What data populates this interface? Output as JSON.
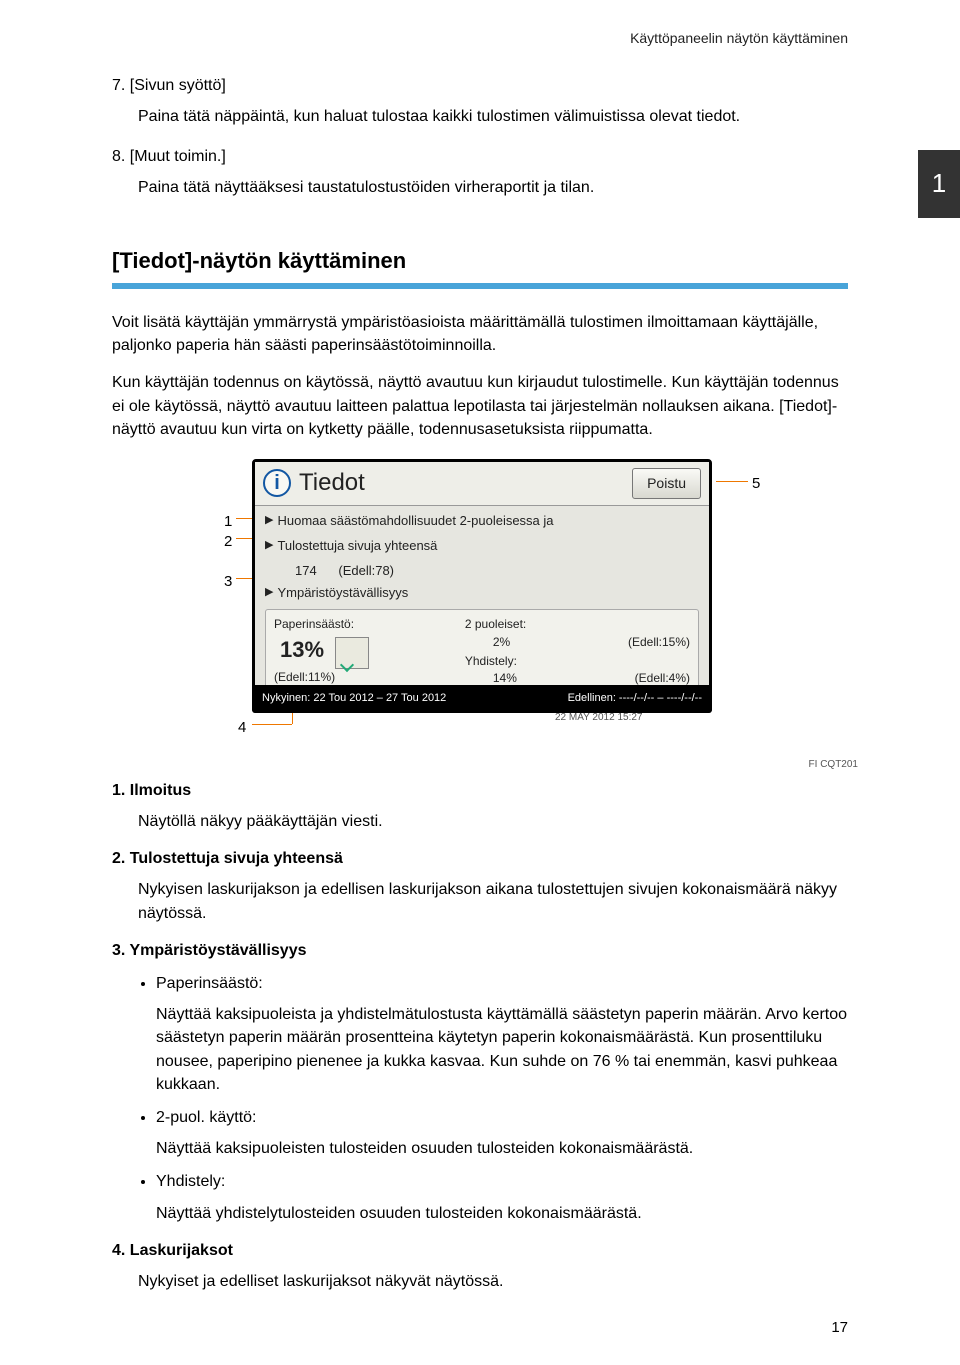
{
  "page": {
    "running_head": "Käyttöpaneelin näytön käyttäminen",
    "chapter_tab": "1",
    "page_number": "17",
    "fig_ref": "FI CQT201"
  },
  "steps": {
    "s7": {
      "head": "7. [Sivun syöttö]",
      "body": "Paina tätä näppäintä, kun haluat tulostaa kaikki tulostimen välimuistissa olevat tiedot."
    },
    "s8": {
      "head": "8. [Muut toimin.]",
      "body": "Paina tätä näyttääksesi taustatulostustöiden virheraportit ja tilan."
    }
  },
  "section": {
    "title": "[Tiedot]-näytön käyttäminen",
    "p1": "Voit lisätä käyttäjän ymmärrystä ympäristöasioista määrittämällä tulostimen ilmoittamaan käyttäjälle, paljonko paperia hän säästi paperinsäästötoiminnoilla.",
    "p2": "Kun käyttäjän todennus on käytössä, näyttö avautuu kun kirjaudut tulostimelle. Kun käyttäjän todennus ei ole käytössä, näyttö avautuu laitteen palattua lepotilasta tai järjestelmän nollauksen aikana. [Tiedot]-näyttö avautuu kun virta on kytketty päälle, todennusasetuksista riippumatta."
  },
  "panel": {
    "title": "Tiedot",
    "exit": "Poistu",
    "row1": "Huomaa säästömahdollisuudet 2-puoleisessa ja",
    "row2": "Tulostettuja sivuja yhteensä",
    "row2_n": "174",
    "row2_prev": "(Edell:78)",
    "row3": "Ympäristöystävällisyys",
    "env": {
      "left_label": "Paperinsäästö:",
      "left_pct": "13%",
      "left_prev": "(Edell:11%)",
      "r1_label": "2 puoleiset:",
      "r1_val": "2%",
      "r1_prev": "(Edell:15%)",
      "r2_label": "Yhdistely:",
      "r2_val": "14%",
      "r2_prev": "(Edell:4%)"
    },
    "bar_left": "Nykyinen: 22 Tou 2012 – 27 Tou 2012",
    "bar_right": "Edellinen:  ----/--/-- – ----/--/--",
    "under": "22 MAY 2012 15:27"
  },
  "callouts": {
    "c1": "1",
    "c2": "2",
    "c3": "3",
    "c4": "4",
    "c5": "5"
  },
  "defs": {
    "d1_head": "1. Ilmoitus",
    "d1_body": "Näytöllä näkyy pääkäyttäjän viesti.",
    "d2_head": "2. Tulostettuja sivuja yhteensä",
    "d2_body": "Nykyisen laskurijakson ja edellisen laskurijakson aikana tulostettujen sivujen kokonaismäärä näkyy näytössä.",
    "d3_head": "3. Ympäristöystävällisyys",
    "d3_b1": "Paperinsäästö:",
    "d3_b1_body": "Näyttää kaksipuoleista ja yhdistelmätulostusta käyttämällä säästetyn paperin määrän. Arvo kertoo säästetyn paperin määrän prosentteina käytetyn paperin kokonaismäärästä. Kun prosenttiluku nousee, paperipino pienenee ja kukka kasvaa. Kun suhde on 76 % tai enemmän, kasvi puhkeaa kukkaan.",
    "d3_b2": "2-puol. käyttö:",
    "d3_b2_body": "Näyttää kaksipuoleisten tulosteiden osuuden tulosteiden kokonaismäärästä.",
    "d3_b3": "Yhdistely:",
    "d3_b3_body": "Näyttää yhdistelytulosteiden osuuden tulosteiden kokonaismäärästä.",
    "d4_head": "4. Laskurijaksot",
    "d4_body": "Nykyiset ja edelliset laskurijaksot näkyvät näytössä."
  }
}
